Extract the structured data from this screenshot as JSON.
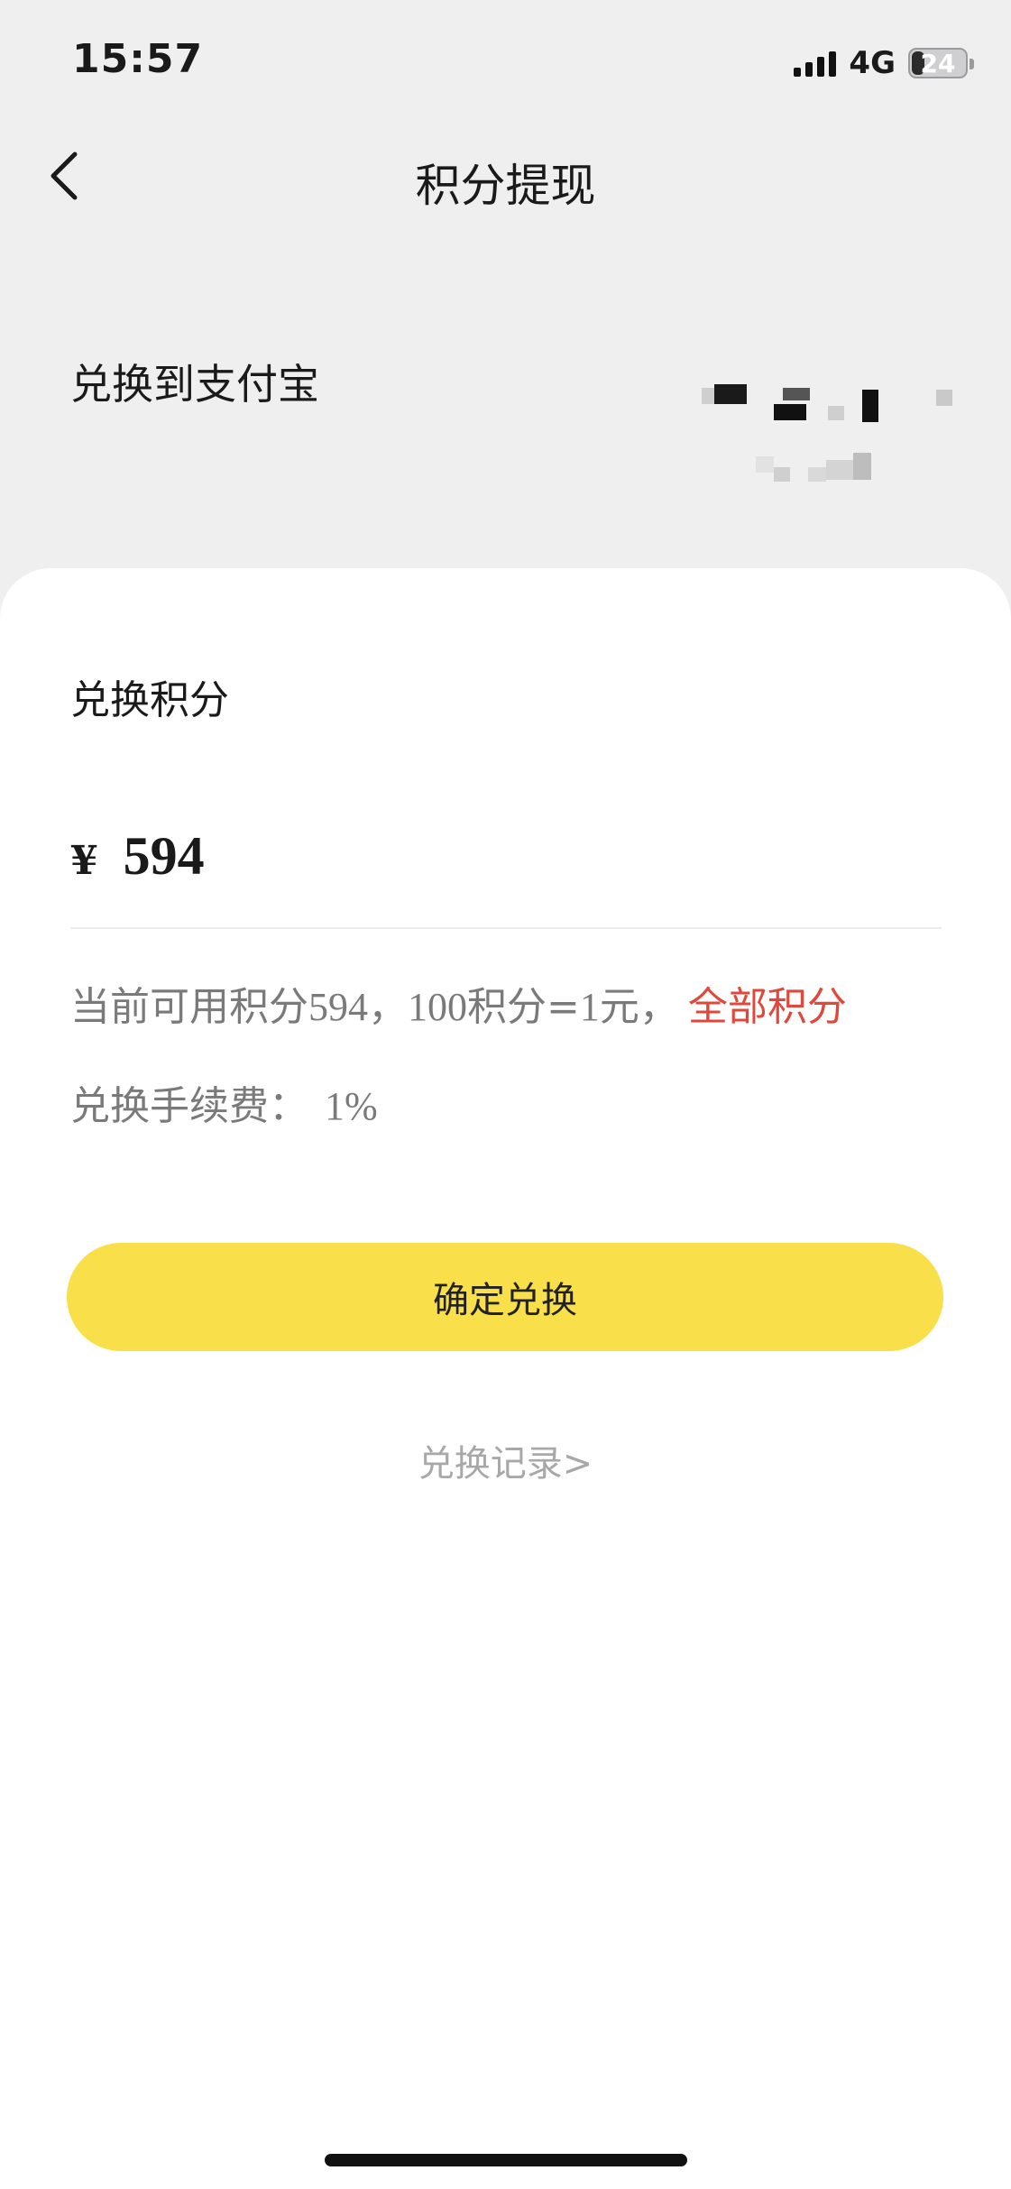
{
  "status_bar": {
    "time": "15:57",
    "network": "4G",
    "battery_level": "24",
    "signal_icon": "signal-bars-icon",
    "battery_icon": "battery-icon"
  },
  "nav": {
    "title": "积分提现",
    "back_icon": "chevron-left-icon"
  },
  "payout": {
    "label": "兑换到支付宝"
  },
  "exchange": {
    "section_title": "兑换积分",
    "currency_symbol": "¥",
    "amount": "594",
    "info_prefix": "当前可用积分",
    "available_points": "594",
    "info_sep1": "，",
    "rate_points": "100",
    "rate_middle": "积分=",
    "rate_yuan": "1",
    "rate_unit": "元，",
    "all_points_label": "全部积分",
    "fee_label": "兑换手续费：",
    "fee_value": "1%",
    "confirm_label": "确定兑换",
    "records_label": "兑换记录>"
  },
  "colors": {
    "accent_yellow": "#f9e04b",
    "link_red": "#e0483c",
    "header_bg": "#efeff0"
  }
}
